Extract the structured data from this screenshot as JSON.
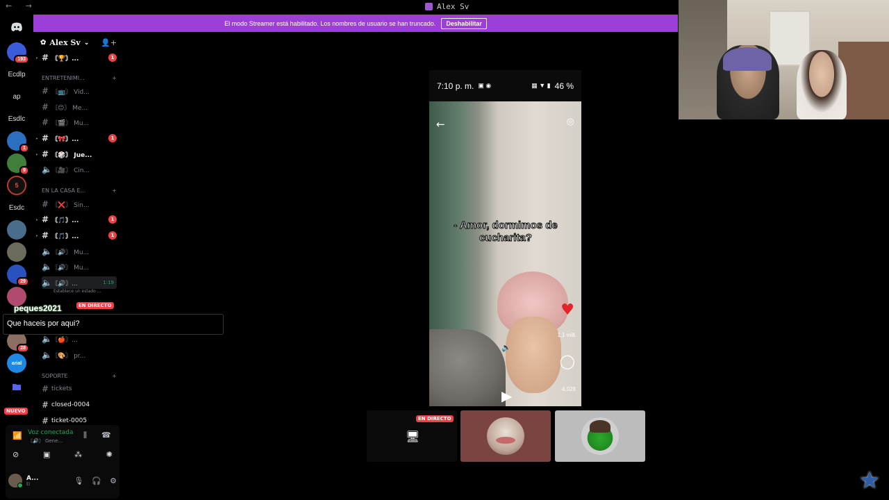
{
  "titlebar": {
    "nav_arrows": "← →",
    "tab_title": "Alex Sv"
  },
  "banner": {
    "message": "El modo Streamer está habilitado. Los nombres de usuario se han truncado.",
    "button": "Deshabilitar"
  },
  "rail": {
    "servers": [
      {
        "name": "discord-home",
        "label": "",
        "badge": ""
      },
      {
        "name": "server-1",
        "label": "",
        "badge": "193"
      },
      {
        "name": "server-ecdlp",
        "label": "Ecdlp",
        "badge": ""
      },
      {
        "name": "server-ap",
        "label": "ap",
        "badge": ""
      },
      {
        "name": "server-esdlc",
        "label": "Esdlc",
        "badge": ""
      },
      {
        "name": "server-2",
        "label": "",
        "badge": "1"
      },
      {
        "name": "server-3",
        "label": "",
        "badge": "9"
      },
      {
        "name": "server-5",
        "label": "5",
        "badge": ""
      },
      {
        "name": "server-esdc",
        "label": "Esdc",
        "badge": ""
      },
      {
        "name": "server-4",
        "label": "",
        "badge": ""
      },
      {
        "name": "server-6",
        "label": "",
        "badge": ""
      },
      {
        "name": "server-7",
        "label": "",
        "badge": "29"
      },
      {
        "name": "server-8",
        "label": "",
        "badge": ""
      },
      {
        "name": "server-9",
        "label": "",
        "badge": "28"
      },
      {
        "name": "server-arial",
        "label": "arial",
        "badge": ""
      },
      {
        "name": "folder",
        "label": "",
        "badge": ""
      }
    ],
    "new_badge": "NUEVO"
  },
  "server": {
    "name": "Alex Sv",
    "channels_top": [
      {
        "label": "〘🏆〙...",
        "badge": "1",
        "bright": true
      }
    ],
    "category1": "ENTRETENIMI...",
    "entertainment": [
      {
        "label": "〘📺〙 Vid...",
        "badge": "",
        "bright": false,
        "voice": false
      },
      {
        "label": "〘😊〙 Me...",
        "badge": "",
        "bright": false,
        "voice": false
      },
      {
        "label": "〘🎬〙 Mu...",
        "badge": "",
        "bright": false,
        "voice": false
      },
      {
        "label": "〘🎀〙...",
        "badge": "1",
        "bright": true,
        "voice": false
      },
      {
        "label": "〘🎲〙 Jue...",
        "badge": "",
        "bright": true,
        "voice": false
      },
      {
        "label": "〘🎥〙 Cin...",
        "badge": "",
        "bright": false,
        "voice": true
      }
    ],
    "category2": "EN LA CASA E...",
    "house": [
      {
        "label": "〘❌〙 Sin...",
        "badge": "",
        "bright": false,
        "voice": false
      },
      {
        "label": "〘🎵〙...",
        "badge": "1",
        "bright": true,
        "voice": false
      },
      {
        "label": "〘🎵〙...",
        "badge": "1",
        "bright": true,
        "voice": false
      },
      {
        "label": "〘🔊〙 Mu...",
        "badge": "",
        "bright": false,
        "voice": true
      },
      {
        "label": "〘🔊〙 Mu...",
        "badge": "",
        "bright": false,
        "voice": true
      },
      {
        "label": "〘🔊〙...",
        "badge": "",
        "bright": false,
        "voice": true,
        "time": "1:19",
        "selected": true
      }
    ],
    "status_hint": "Establece un estado ...",
    "more": [
      {
        "label": "〘🍎〙...",
        "voice": true
      },
      {
        "label": "〘🎨〙 pr...",
        "voice": true
      }
    ],
    "category3": "SOPORTE",
    "support": [
      {
        "label": "tickets",
        "bright": false
      },
      {
        "label": "closed-0004",
        "bright": true
      },
      {
        "label": "ticket-0005",
        "bright": true
      }
    ]
  },
  "chat": {
    "username": "peques2021",
    "live_tag": "EN DIRECTO",
    "message": "Que haceis por aqui?"
  },
  "voice": {
    "title": "Voz conectada",
    "channel": "〘🔊〙 Gene..."
  },
  "me": {
    "name": "A...",
    "status": "Ei"
  },
  "phone": {
    "time": "7:10 p. m.",
    "battery": "46 %",
    "caption": "- Amor, dormimos de cucharita?",
    "likes": "1,1 mill.",
    "comments": "4,028"
  },
  "tiles": {
    "live_tag": "EN DIRECTO"
  },
  "colors": {
    "banner": "#9b3fd8",
    "live": "#f23f43",
    "connected": "#23a55a"
  }
}
